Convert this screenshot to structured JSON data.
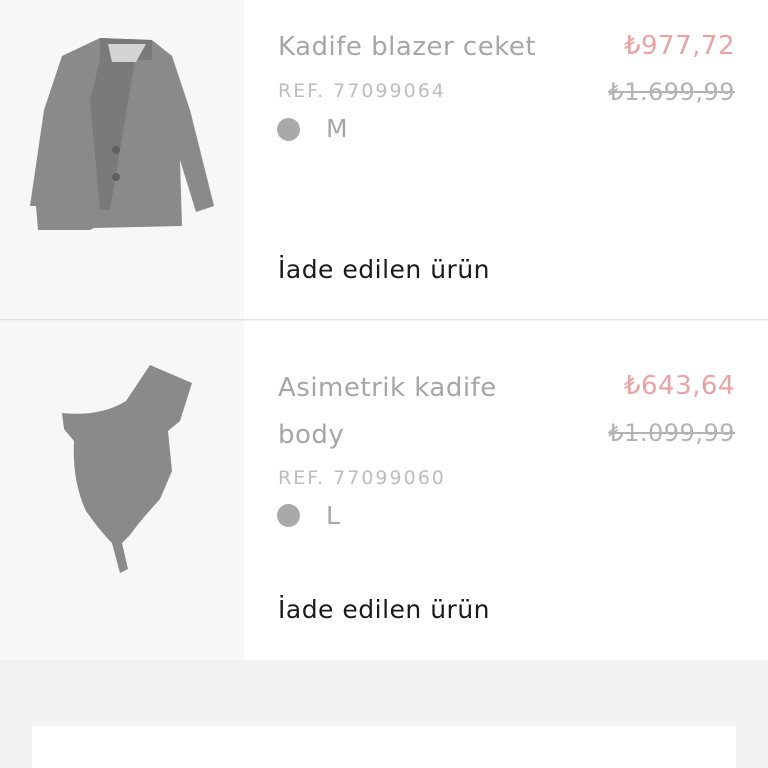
{
  "items": [
    {
      "name": "Kadife blazer ceket",
      "ref": "REF. 77099064",
      "size": "M",
      "price_new": "₺977,72",
      "price_old": "₺1.699,99",
      "status": "İade edilen ürün",
      "image_icon": "blazer-jacket-image",
      "swatch_color": "#a9a9a9"
    },
    {
      "name_line1": "Asimetrik kadife",
      "name_line2": "body",
      "ref": "REF. 77099060",
      "size": "L",
      "price_new": "₺643,64",
      "price_old": "₺1.099,99",
      "status": "İade edilen ürün",
      "image_icon": "bodysuit-image",
      "swatch_color": "#a9a9a9"
    }
  ],
  "colors": {
    "sale_price": "#e9a3a3",
    "muted_text": "#a6a6a6",
    "page_background": "#f2f2f2"
  }
}
